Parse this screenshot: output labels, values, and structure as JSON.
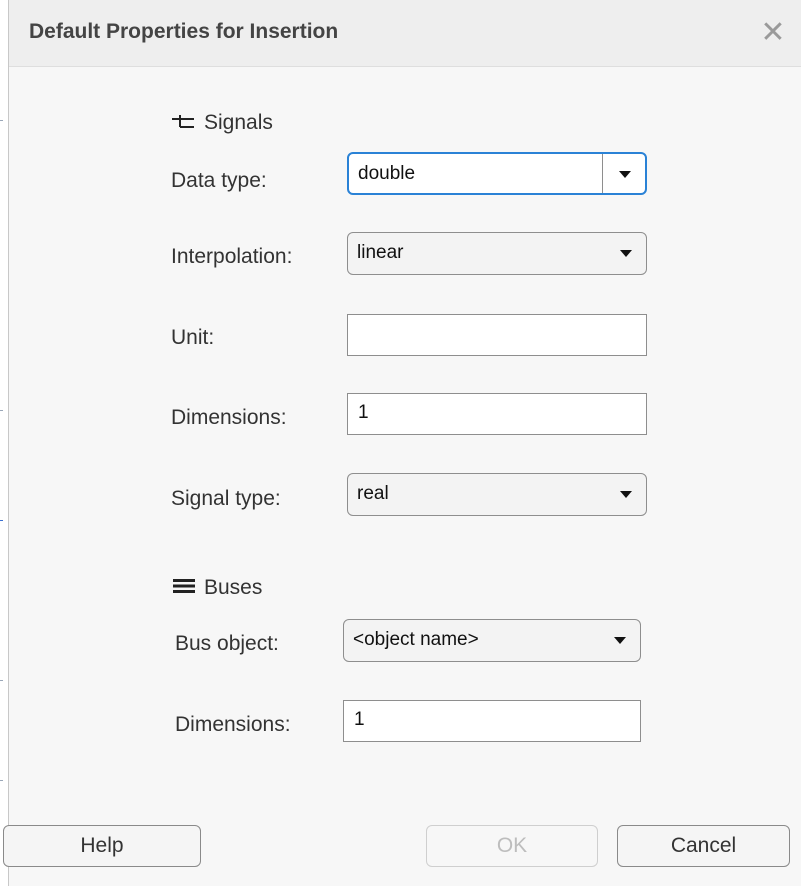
{
  "dialog": {
    "title": "Default Properties for Insertion",
    "close_glyph": "✕"
  },
  "signals": {
    "section_label": "Signals",
    "icon": "signal-icon",
    "data_type": {
      "label": "Data type:",
      "value": "double"
    },
    "interpolation": {
      "label": "Interpolation:",
      "value": "linear"
    },
    "unit": {
      "label": "Unit:",
      "value": ""
    },
    "dimensions": {
      "label": "Dimensions:",
      "value": "1"
    },
    "signal_type": {
      "label": "Signal type:",
      "value": "real"
    }
  },
  "buses": {
    "section_label": "Buses",
    "icon": "bus-icon",
    "bus_object": {
      "label": "Bus object:",
      "value": "<object name>"
    },
    "dimensions": {
      "label": "Dimensions:",
      "value": "1"
    }
  },
  "buttons": {
    "help": "Help",
    "ok": "OK",
    "cancel": "Cancel"
  },
  "colors": {
    "focus_border": "#2a82d6",
    "title_bar": "#eeeeee",
    "dialog_bg": "#f7f7f7"
  }
}
